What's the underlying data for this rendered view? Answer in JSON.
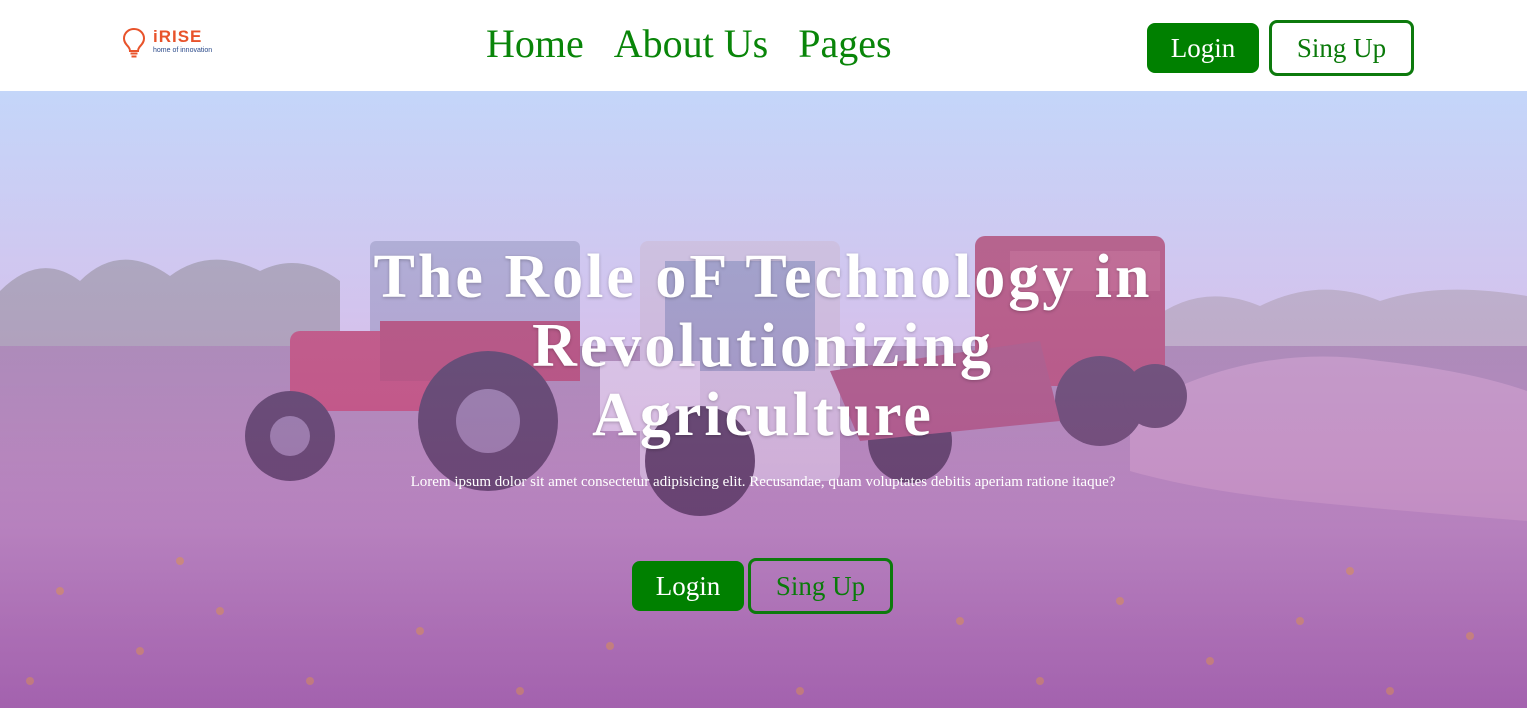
{
  "brand": {
    "name": "iRISE",
    "tagline": "home of innovation",
    "accent_color": "#e8532b",
    "icon": "lightbulb-icon"
  },
  "nav": {
    "links": [
      "Home",
      "About Us",
      "Pages"
    ],
    "login_label": "Login",
    "signup_label": "Sing Up",
    "link_color": "#098509"
  },
  "hero": {
    "title": "The Role oF Technology in Revolutionizing Agriculture",
    "subtitle": "Lorem ipsum dolor sit amet consectetur adipisicing elit. Recusandae, quam voluptates debitis aperiam ratione itaque?",
    "login_label": "Login",
    "signup_label": "Sing Up",
    "background": "tractors-in-field-photo",
    "overlay_color": "#b06ecf"
  },
  "colors": {
    "primary_green": "#008000",
    "white": "#ffffff"
  }
}
